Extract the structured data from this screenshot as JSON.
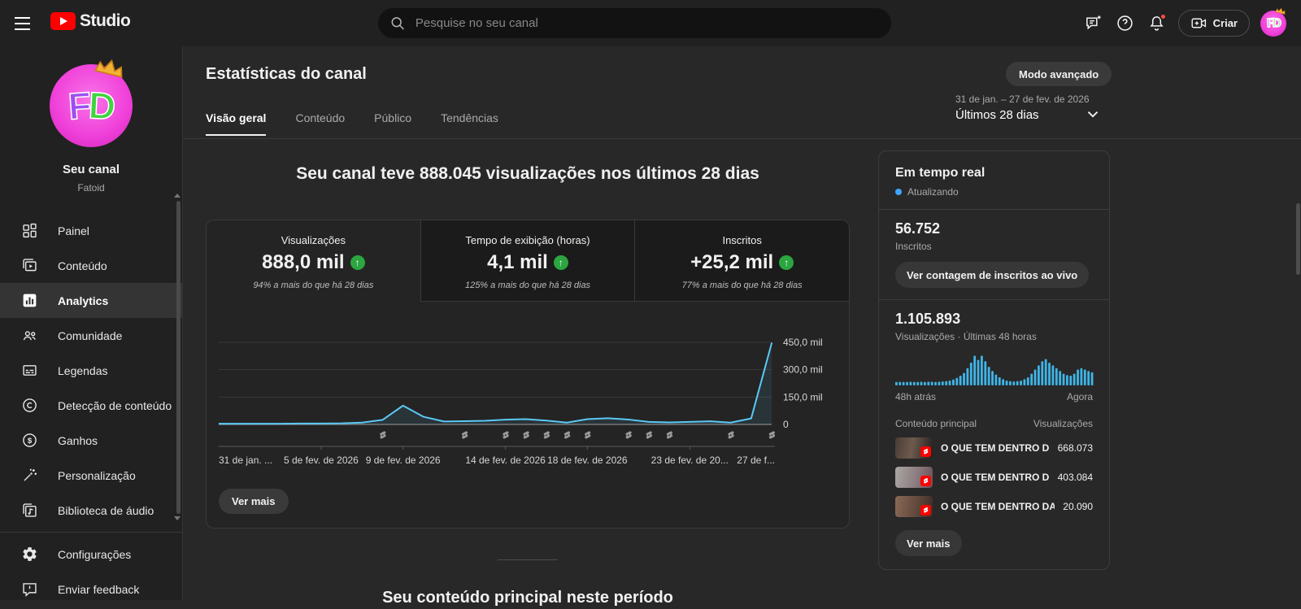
{
  "topbar": {
    "product_name": "Studio",
    "search_placeholder": "Pesquise no seu canal",
    "create_label": "Criar"
  },
  "sidebar": {
    "channel_label": "Seu canal",
    "channel_name": "Fatoid",
    "avatar_letters": {
      "first": "F",
      "second": "D"
    },
    "items": [
      {
        "label": "Painel"
      },
      {
        "label": "Conteúdo"
      },
      {
        "label": "Analytics"
      },
      {
        "label": "Comunidade"
      },
      {
        "label": "Legendas"
      },
      {
        "label": "Detecção de conteúdo"
      },
      {
        "label": "Ganhos"
      },
      {
        "label": "Personalização"
      },
      {
        "label": "Biblioteca de áudio"
      },
      {
        "label": "Configurações"
      },
      {
        "label": "Enviar feedback"
      }
    ]
  },
  "header": {
    "title": "Estatísticas do canal",
    "tabs": [
      {
        "label": "Visão geral"
      },
      {
        "label": "Conteúdo"
      },
      {
        "label": "Público"
      },
      {
        "label": "Tendências"
      }
    ],
    "advanced_button": "Modo avançado",
    "date_range": "31 de jan. – 27 de fev. de 2026",
    "date_preset": "Últimos 28 dias"
  },
  "overview": {
    "headline": "Seu canal teve 888.045 visualizações nos últimos 28 dias",
    "metrics": [
      {
        "label": "Visualizações",
        "value": "888,0 mil",
        "delta": "94% a mais do que há 28 dias"
      },
      {
        "label": "Tempo de exibição (horas)",
        "value": "4,1 mil",
        "delta": "125% a mais do que há 28 dias"
      },
      {
        "label": "Inscritos",
        "value": "+25,2 mil",
        "delta": "77% a mais do que há 28 dias"
      }
    ],
    "see_more_label": "Ver mais"
  },
  "chart_data": [
    {
      "id": "views-last-28-days",
      "type": "line",
      "x_unit": "day",
      "days_total": 27,
      "x_tick_labels": [
        "31 de jan. ...",
        "5 de fev. de 2026",
        "9 de fev. de 2026",
        "14 de fev. de 2026",
        "18 de fev. de 2026",
        "23 de fev. de 20...",
        "27 de f..."
      ],
      "x_tick_days": [
        0,
        5,
        9,
        14,
        18,
        23,
        27
      ],
      "values_mil": [
        4,
        4,
        4,
        4,
        5,
        5,
        6,
        10,
        25,
        103,
        42,
        16,
        18,
        20,
        26,
        29,
        21,
        10,
        29,
        34,
        27,
        14,
        11,
        14,
        17,
        10,
        33,
        445
      ],
      "ylim_mil": [
        0,
        450
      ],
      "y_tick_values": [
        0,
        150,
        300,
        450
      ],
      "y_tick_labels": [
        "0",
        "150,0 mil",
        "300,0 mil",
        "450,0 mil"
      ],
      "shorts_marker_days": [
        8,
        12,
        14,
        15,
        16,
        17,
        18,
        20,
        21,
        22,
        25,
        27
      ]
    },
    {
      "id": "views-last-48-hours",
      "type": "bar",
      "values_norm": [
        0.05,
        0.05,
        0.05,
        0.05,
        0.06,
        0.05,
        0.05,
        0.06,
        0.05,
        0.06,
        0.06,
        0.05,
        0.06,
        0.07,
        0.08,
        0.1,
        0.14,
        0.2,
        0.28,
        0.38,
        0.55,
        0.75,
        1.0,
        0.85,
        1.0,
        0.8,
        0.6,
        0.45,
        0.32,
        0.22,
        0.15,
        0.1,
        0.08,
        0.07,
        0.08,
        0.1,
        0.15,
        0.22,
        0.35,
        0.5,
        0.65,
        0.8,
        0.88,
        0.75,
        0.65,
        0.55,
        0.45,
        0.35,
        0.3,
        0.28,
        0.35,
        0.5,
        0.55,
        0.5,
        0.45,
        0.4
      ]
    }
  ],
  "realtime": {
    "title": "Em tempo real",
    "status": "Atualizando",
    "subscribers": "56.752",
    "subscribers_label": "Inscritos",
    "live_count_button": "Ver contagem de inscritos ao vivo",
    "views": "1.105.893",
    "views_label": "Visualizações · Últimas 48 horas",
    "spark_start": "48h atrás",
    "spark_end": "Agora",
    "col_content": "Conteúdo principal",
    "col_views": "Visualizações",
    "rows": [
      {
        "title": "O QUE TEM DENTRO D...",
        "views": "668.073"
      },
      {
        "title": "O QUE TEM DENTRO D...",
        "views": "403.084"
      },
      {
        "title": "O QUE TEM DENTRO DA...",
        "views": "20.090"
      }
    ],
    "see_more_label": "Ver mais"
  },
  "bottom": {
    "section_title": "Seu conteúdo principal neste período"
  },
  "colors": {
    "accent_blue": "#3ea6ff",
    "chart_line": "#5bc9f5",
    "chart_area": "rgba(91,201,245,0.10)",
    "realtime_bars": "#3fb5e8",
    "positive_green": "#2ba640",
    "brand_red": "#ff0000",
    "notification_red": "#fa4b43"
  }
}
